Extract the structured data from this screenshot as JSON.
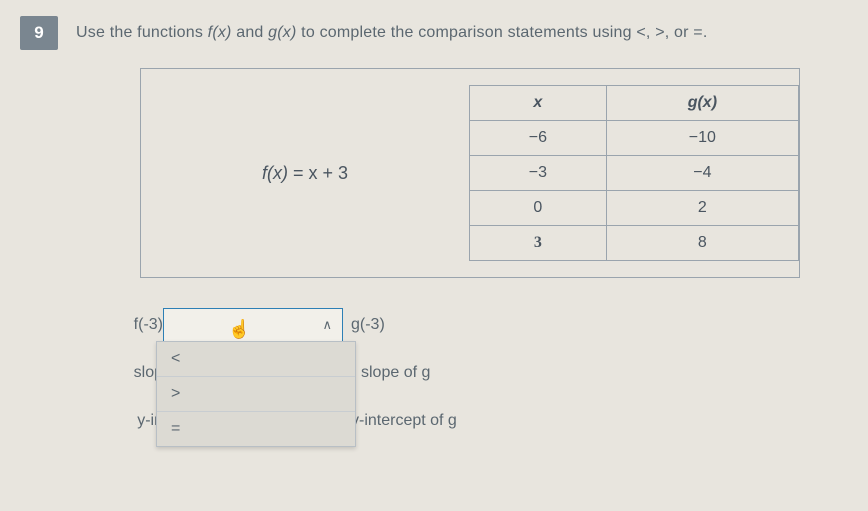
{
  "question_number": "9",
  "prompt_pre": "Use the functions ",
  "prompt_f": "f(x)",
  "prompt_mid": " and ",
  "prompt_g": "g(x)",
  "prompt_post": " to complete the comparison statements using <, >, or =.",
  "f_equation_lhs": "f(x)",
  "f_equation_eq": " = ",
  "f_equation_rhs": "x + 3",
  "g_table": {
    "head_x": "x",
    "head_gx": "g(x)",
    "rows": [
      {
        "x": "−6",
        "gx": "−10"
      },
      {
        "x": "−3",
        "gx": "−4"
      },
      {
        "x": "0",
        "gx": "2"
      },
      {
        "x": "3",
        "gx": "8"
      }
    ]
  },
  "compare": {
    "r1_left": "f(-3)",
    "r1_right": "g(-3)",
    "r2_left": "slop",
    "r2_right": "slope of g",
    "r3_left": "y-in",
    "r3_right": "y-intercept of g"
  },
  "dropdown": {
    "opt_lt": "<",
    "opt_gt": ">",
    "opt_eq": "="
  },
  "caret_up": "∧",
  "caret_down": "∨",
  "cursor_glyph": "👆"
}
